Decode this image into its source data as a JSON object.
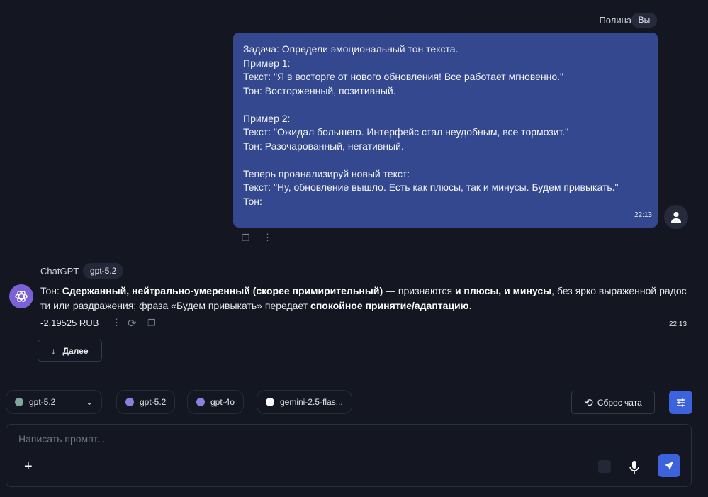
{
  "user": {
    "name": "Полина",
    "badge": "Вы",
    "message": "Задача: Определи эмоциональный тон текста.\nПример 1:\nТекст: \"Я в восторге от нового обновления! Все работает мгновенно.\"\nТон: Восторженный, позитивный.\n\nПример 2:\nТекст: \"Ожидал большего. Интерфейс стал неудобным, все тормозит.\"\nТон: Разочарованный, негативный.\n\nТеперь проанализируй новый текст:\nТекст: \"Ну, обновление вышло. Есть как плюсы, так и минусы. Будем привыкать.\"\nТон:",
    "time": "22:13"
  },
  "assistant": {
    "name": "ChatGPT",
    "model": "gpt-5.2",
    "parts": [
      "Тон: ",
      "Сдержанный, нейтрально-умеренный (скорее примирительный)",
      " — признаются ",
      "и плюсы, и минусы",
      ", без ярко выраженной радости или раздражения; фраза «Будем привыкать» передает ",
      "спокойное принятие/адаптацию",
      "."
    ],
    "cost": "-2.19525 RUB",
    "time": "22:13"
  },
  "next_label": "Далее",
  "model_select": {
    "value": "gpt-5.2"
  },
  "quick_models": [
    {
      "label": "gpt-5.2",
      "color": "#8b7fe0"
    },
    {
      "label": "gpt-4o",
      "color": "#8b7fe0"
    },
    {
      "label": "gemini-2.5-flas...",
      "color": "#ffffff"
    }
  ],
  "reset_label": "Сброс чата",
  "composer": {
    "placeholder": "Написать промпт..."
  },
  "colors": {
    "accent": "#3d63dc",
    "bubble": "#34488f",
    "background": "#141722"
  }
}
